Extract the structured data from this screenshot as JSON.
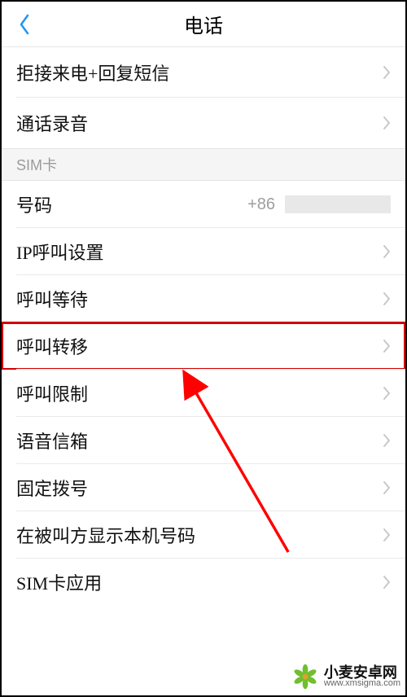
{
  "header": {
    "title": "电话"
  },
  "group_top": [
    {
      "label": "拒接来电+回复短信",
      "chevron": true
    },
    {
      "label": "通话录音",
      "chevron": true
    }
  ],
  "section_sim": {
    "header": "SIM卡",
    "items": [
      {
        "label": "号码",
        "value_prefix": "+86",
        "value_masked": true,
        "chevron": false
      },
      {
        "label": "IP呼叫设置",
        "chevron": true
      },
      {
        "label": "呼叫等待",
        "chevron": true
      },
      {
        "label": "呼叫转移",
        "chevron": true,
        "highlighted": true
      },
      {
        "label": "呼叫限制",
        "chevron": true
      },
      {
        "label": "语音信箱",
        "chevron": true
      },
      {
        "label": "固定拨号",
        "chevron": true
      },
      {
        "label": "在被叫方显示本机号码",
        "chevron": true
      },
      {
        "label": "SIM卡应用",
        "chevron": true
      }
    ]
  },
  "watermark": {
    "brand": "小麦安卓网",
    "url": "www.xmsigma.com"
  },
  "colors": {
    "back_arrow": "#2196f3",
    "chevron": "#c8c8c8",
    "highlight": "#d40000",
    "arrow": "#ff0000"
  }
}
